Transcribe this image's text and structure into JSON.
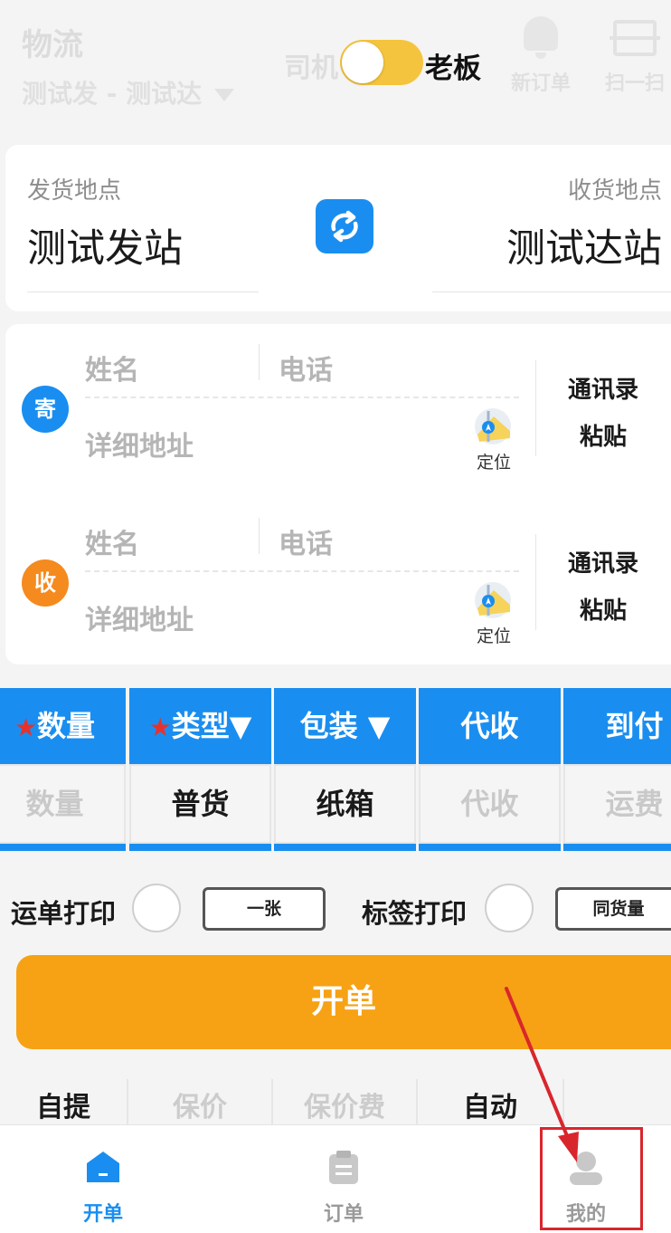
{
  "header": {
    "app_title": "物流",
    "route": "测试发 - 测试达",
    "role_left": "司机",
    "role_right": "老板",
    "new_order_label": "新订单",
    "scan_label": "扫一扫"
  },
  "stations": {
    "from_label": "发货地点",
    "from_value": "测试发站",
    "to_label": "收货地点",
    "to_value": "测试达站"
  },
  "sender": {
    "badge": "寄",
    "name_placeholder": "姓名",
    "phone_placeholder": "电话",
    "address_placeholder": "详细地址",
    "locate_label": "定位",
    "contacts_label": "通讯录",
    "paste_label": "粘贴"
  },
  "receiver": {
    "badge": "收",
    "name_placeholder": "姓名",
    "phone_placeholder": "电话",
    "address_placeholder": "详细地址",
    "locate_label": "定位",
    "contacts_label": "通讯录",
    "paste_label": "粘贴"
  },
  "goods": {
    "columns": [
      {
        "header": "数量",
        "required": true,
        "dropdown": false,
        "value": "数量",
        "is_placeholder": true
      },
      {
        "header": "类型▼",
        "required": true,
        "dropdown": true,
        "value": "普货",
        "is_placeholder": false
      },
      {
        "header": "包装 ▼",
        "required": false,
        "dropdown": true,
        "value": "纸箱",
        "is_placeholder": false
      },
      {
        "header": "代收",
        "required": false,
        "dropdown": false,
        "value": "代收",
        "is_placeholder": true
      },
      {
        "header": "到付",
        "required": false,
        "dropdown": false,
        "value": "运费",
        "is_placeholder": true
      }
    ],
    "required_mark": "★"
  },
  "print": {
    "waybill_label": "运单打印",
    "waybill_option": "一张",
    "tag_label": "标签打印",
    "tag_option": "同货量"
  },
  "submit_label": "开单",
  "extra_row": {
    "cells": [
      "自提",
      "保价",
      "保价费",
      "自动"
    ]
  },
  "tabbar": {
    "tabs": [
      {
        "label": "开单",
        "active": true
      },
      {
        "label": "订单",
        "active": false
      },
      {
        "label": "我的",
        "active": false
      }
    ]
  },
  "colors": {
    "primary": "#1a8ef0",
    "accent": "#f6a214",
    "toggle": "#f5c43e",
    "required": "#e6322c",
    "highlight": "#d9262c"
  }
}
